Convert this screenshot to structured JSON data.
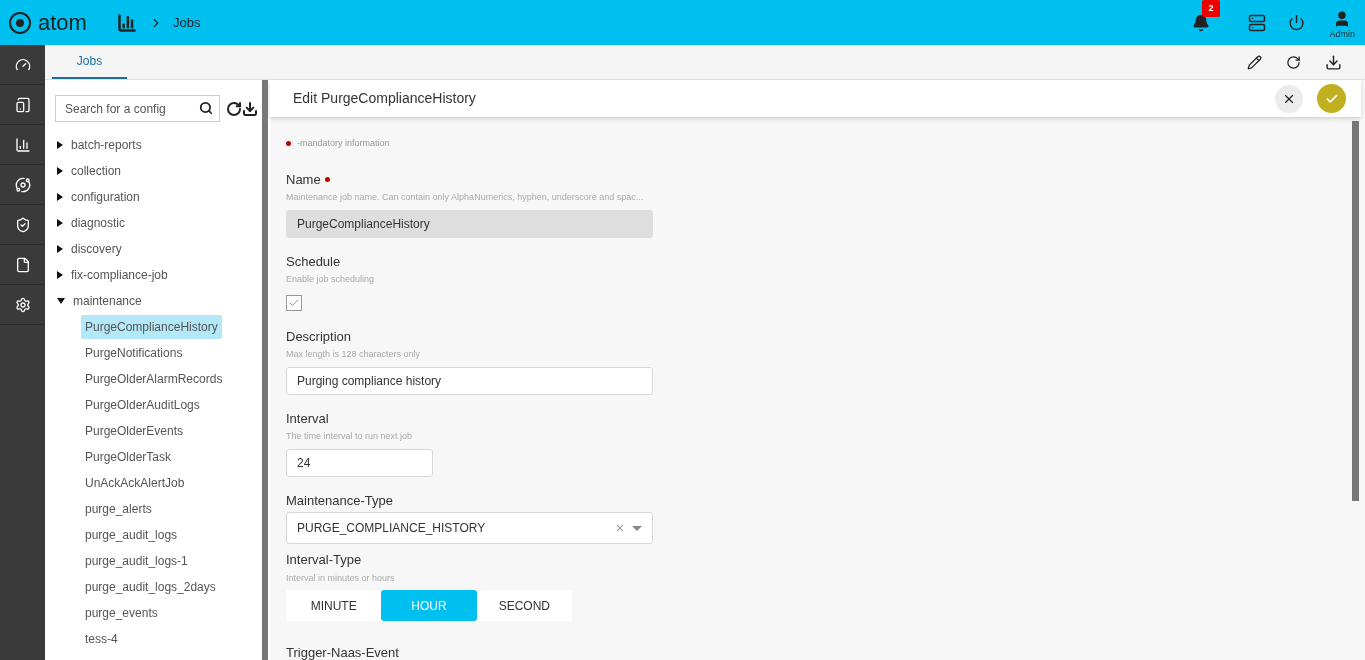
{
  "topbar": {
    "logo": "atom",
    "breadcrumb": "Jobs",
    "notifications": "2",
    "user": "Admin"
  },
  "tabs": [
    {
      "label": "Jobs",
      "selected": true
    }
  ],
  "sidebar": {
    "search": {
      "placeholder": "Search for a config"
    },
    "tree": [
      {
        "label": "batch-reports",
        "expanded": false
      },
      {
        "label": "collection",
        "expanded": false
      },
      {
        "label": "configuration",
        "expanded": false
      },
      {
        "label": "diagnostic",
        "expanded": false
      },
      {
        "label": "discovery",
        "expanded": false
      },
      {
        "label": "fix-compliance-job",
        "expanded": false
      },
      {
        "label": "maintenance",
        "expanded": true,
        "children": [
          {
            "label": "PurgeComplianceHistory",
            "selected": true
          },
          {
            "label": "PurgeNotifications",
            "selected": false
          },
          {
            "label": "PurgeOlderAlarmRecords",
            "selected": false
          },
          {
            "label": "PurgeOlderAuditLogs",
            "selected": false
          },
          {
            "label": "PurgeOlderEvents",
            "selected": false
          },
          {
            "label": "PurgeOlderTask",
            "selected": false
          },
          {
            "label": "UnAckAckAlertJob",
            "selected": false
          },
          {
            "label": "purge_alerts",
            "selected": false
          },
          {
            "label": "purge_audit_logs",
            "selected": false
          },
          {
            "label": "purge_audit_logs-1",
            "selected": false
          },
          {
            "label": "purge_audit_logs_2days",
            "selected": false
          },
          {
            "label": "purge_events",
            "selected": false
          },
          {
            "label": "tess-4",
            "selected": false
          }
        ]
      }
    ]
  },
  "editor": {
    "title": "Edit PurgeComplianceHistory",
    "mandatory_note": "-mandatory information",
    "fields": [
      {
        "kind": "text",
        "label": "Name",
        "required": true,
        "hint": "Maintenance job name. Can contain only AlphaNumerics, hyphen, underscore and spac...",
        "value": "PurgeComplianceHistory",
        "disabled": true
      },
      {
        "kind": "checkbox",
        "label": "Schedule",
        "required": false,
        "hint": "Enable job scheduling",
        "checked": true
      },
      {
        "kind": "text",
        "label": "Description",
        "required": false,
        "hint": "Max length is 128 characters only",
        "value": "Purging compliance history",
        "disabled": false
      },
      {
        "kind": "short",
        "label": "Interval",
        "required": false,
        "hint": "The time interval to run next job",
        "value": "24",
        "disabled": false
      },
      {
        "kind": "select",
        "label": "Maintenance-Type",
        "required": false,
        "value": "PURGE_COMPLIANCE_HISTORY",
        "clear": "×"
      },
      {
        "kind": "segmented",
        "label": "Interval-Type",
        "required": false,
        "hint": "Interval in minutes or hours",
        "options": [
          {
            "label": "MINUTE",
            "selected": false
          },
          {
            "label": "HOUR",
            "selected": true
          },
          {
            "label": "SECOND",
            "selected": false
          }
        ]
      },
      {
        "kind": "label",
        "label": "Trigger-Naas-Event",
        "required": false
      }
    ]
  }
}
